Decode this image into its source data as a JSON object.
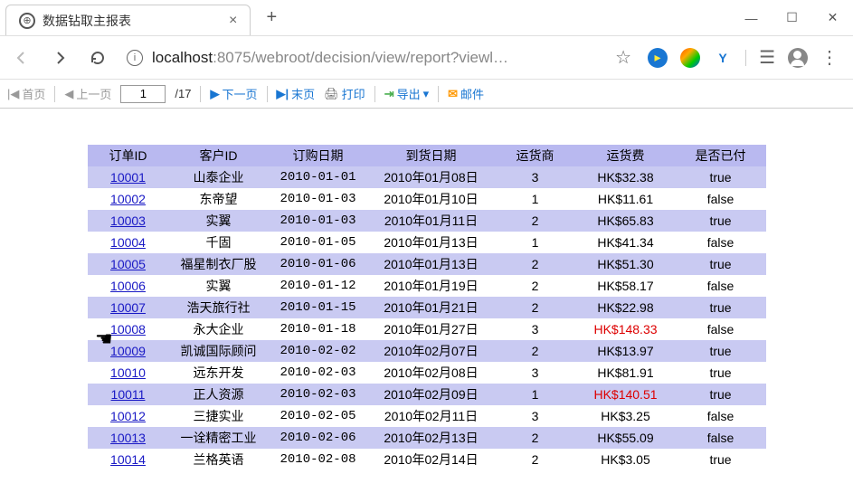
{
  "window": {
    "tab_title": "数据钻取主报表",
    "win_min": "—",
    "win_max": "☐",
    "win_close": "✕"
  },
  "addr": {
    "scheme": "localhost",
    "port_path": ":8075/webroot/decision/view/report?viewl…"
  },
  "toolbar": {
    "first": "首页",
    "prev": "上一页",
    "page": "1",
    "total_pages_label": "/17",
    "next": "下一页",
    "last": "末页",
    "print": "打印",
    "export": "导出",
    "mail": "邮件"
  },
  "table": {
    "headers": {
      "order_id": "订单ID",
      "customer": "客户ID",
      "order_date": "订购日期",
      "arrive_date": "到货日期",
      "shipper": "运货商",
      "fee": "运货费",
      "paid": "是否已付"
    },
    "rows": [
      {
        "id": "10001",
        "cust": "山泰企业",
        "odate": "2010-01-01",
        "adate": "2010年01月08日",
        "ship": "3",
        "fee": "HK$32.38",
        "paid": "true",
        "fee_red": false
      },
      {
        "id": "10002",
        "cust": "东帝望",
        "odate": "2010-01-03",
        "adate": "2010年01月10日",
        "ship": "1",
        "fee": "HK$11.61",
        "paid": "false",
        "fee_red": false
      },
      {
        "id": "10003",
        "cust": "实翼",
        "odate": "2010-01-03",
        "adate": "2010年01月11日",
        "ship": "2",
        "fee": "HK$65.83",
        "paid": "true",
        "fee_red": false
      },
      {
        "id": "10004",
        "cust": "千固",
        "odate": "2010-01-05",
        "adate": "2010年01月13日",
        "ship": "1",
        "fee": "HK$41.34",
        "paid": "false",
        "fee_red": false
      },
      {
        "id": "10005",
        "cust": "福星制衣厂股",
        "odate": "2010-01-06",
        "adate": "2010年01月13日",
        "ship": "2",
        "fee": "HK$51.30",
        "paid": "true",
        "fee_red": false
      },
      {
        "id": "10006",
        "cust": "实翼",
        "odate": "2010-01-12",
        "adate": "2010年01月19日",
        "ship": "2",
        "fee": "HK$58.17",
        "paid": "false",
        "fee_red": false
      },
      {
        "id": "10007",
        "cust": "浩天旅行社",
        "odate": "2010-01-15",
        "adate": "2010年01月21日",
        "ship": "2",
        "fee": "HK$22.98",
        "paid": "true",
        "fee_red": false
      },
      {
        "id": "10008",
        "cust": "永大企业",
        "odate": "2010-01-18",
        "adate": "2010年01月27日",
        "ship": "3",
        "fee": "HK$148.33",
        "paid": "false",
        "fee_red": true
      },
      {
        "id": "10009",
        "cust": "凯诚国际顾问",
        "odate": "2010-02-02",
        "adate": "2010年02月07日",
        "ship": "2",
        "fee": "HK$13.97",
        "paid": "true",
        "fee_red": false
      },
      {
        "id": "10010",
        "cust": "远东开发",
        "odate": "2010-02-03",
        "adate": "2010年02月08日",
        "ship": "3",
        "fee": "HK$81.91",
        "paid": "true",
        "fee_red": false
      },
      {
        "id": "10011",
        "cust": "正人资源",
        "odate": "2010-02-03",
        "adate": "2010年02月09日",
        "ship": "1",
        "fee": "HK$140.51",
        "paid": "true",
        "fee_red": true
      },
      {
        "id": "10012",
        "cust": "三捷实业",
        "odate": "2010-02-05",
        "adate": "2010年02月11日",
        "ship": "3",
        "fee": "HK$3.25",
        "paid": "false",
        "fee_red": false
      },
      {
        "id": "10013",
        "cust": "一诠精密工业",
        "odate": "2010-02-06",
        "adate": "2010年02月13日",
        "ship": "2",
        "fee": "HK$55.09",
        "paid": "false",
        "fee_red": false
      },
      {
        "id": "10014",
        "cust": "兰格英语",
        "odate": "2010-02-08",
        "adate": "2010年02月14日",
        "ship": "2",
        "fee": "HK$3.05",
        "paid": "true",
        "fee_red": false
      }
    ]
  }
}
